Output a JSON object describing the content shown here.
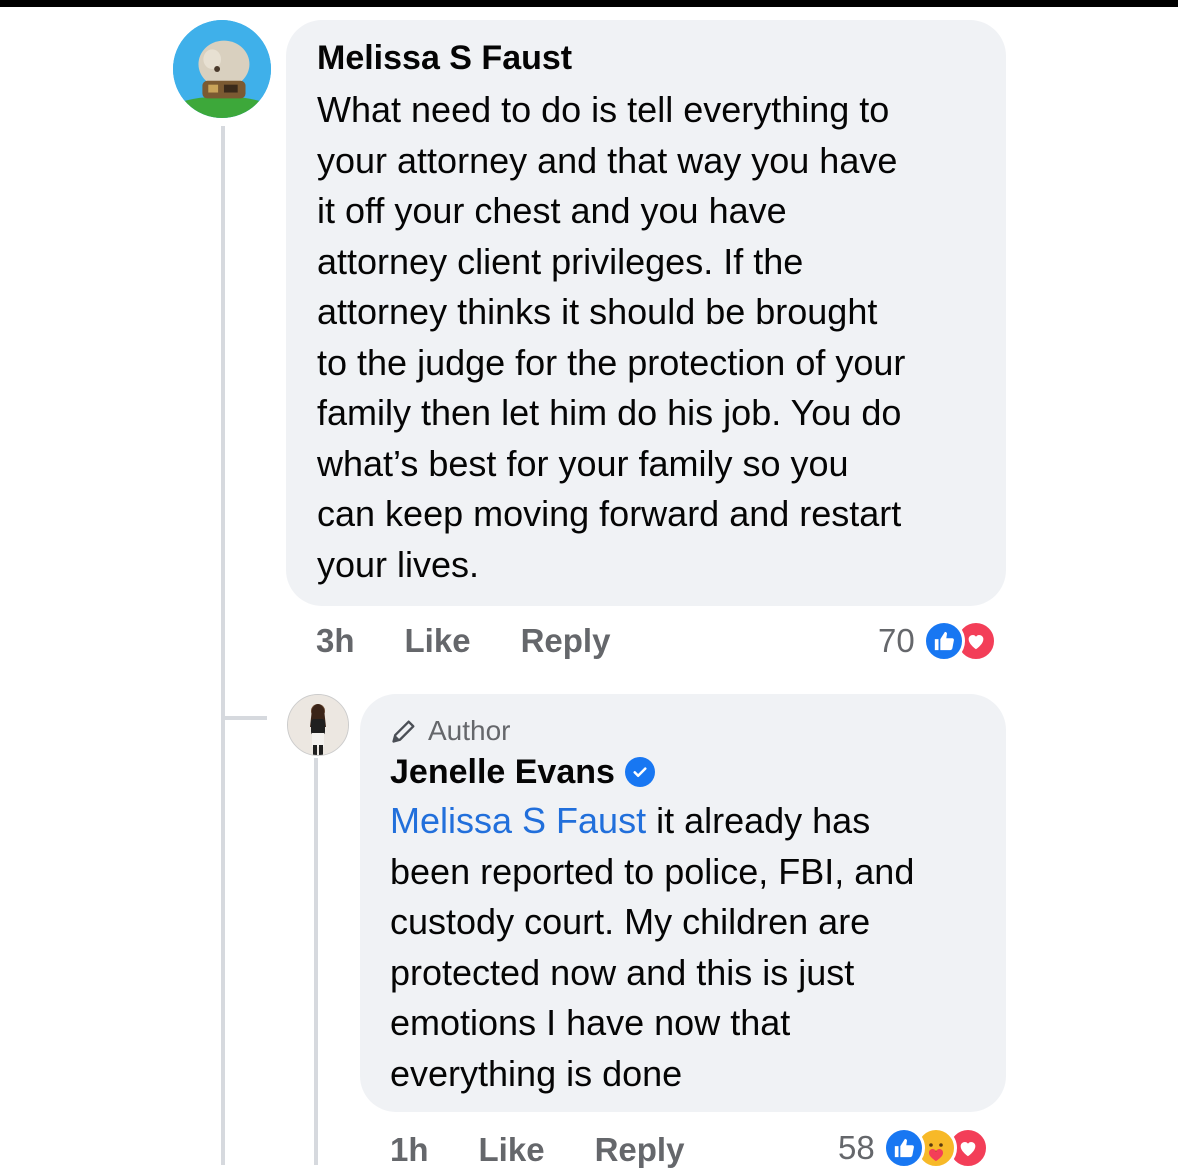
{
  "comment": {
    "author": "Melissa S Faust",
    "lines": [
      "What need to do is tell everything to",
      "your attorney and that way you have",
      "it off your chest and you have",
      "attorney client privileges. If the",
      "attorney thinks it should be brought",
      "to the judge for the protection of your",
      "family then let him do his job. You do",
      "what’s best for your family so you",
      "can keep moving forward and restart",
      "your lives."
    ],
    "time": "3h",
    "like_label": "Like",
    "reply_label": "Reply",
    "reaction_count": "70",
    "reactions": [
      "like-icon",
      "love-icon"
    ]
  },
  "reply": {
    "badge": "Author",
    "author": "Jenelle Evans",
    "mention": "Melissa S Faust",
    "first_line_rest": " it already has",
    "lines": [
      "been reported to police, FBI, and",
      "custody court. My children are",
      "protected now and this is just",
      "emotions I have now that",
      "everything is done"
    ],
    "time": "1h",
    "like_label": "Like",
    "reply_label": "Reply",
    "reaction_count": "58",
    "reactions": [
      "like-icon",
      "care-icon",
      "love-icon"
    ]
  },
  "colors": {
    "bubble": "#f0f2f5",
    "meta_text": "#65676b",
    "mention": "#216fdb",
    "like_blue": "#1877f2",
    "love_red": "#f33e58"
  }
}
